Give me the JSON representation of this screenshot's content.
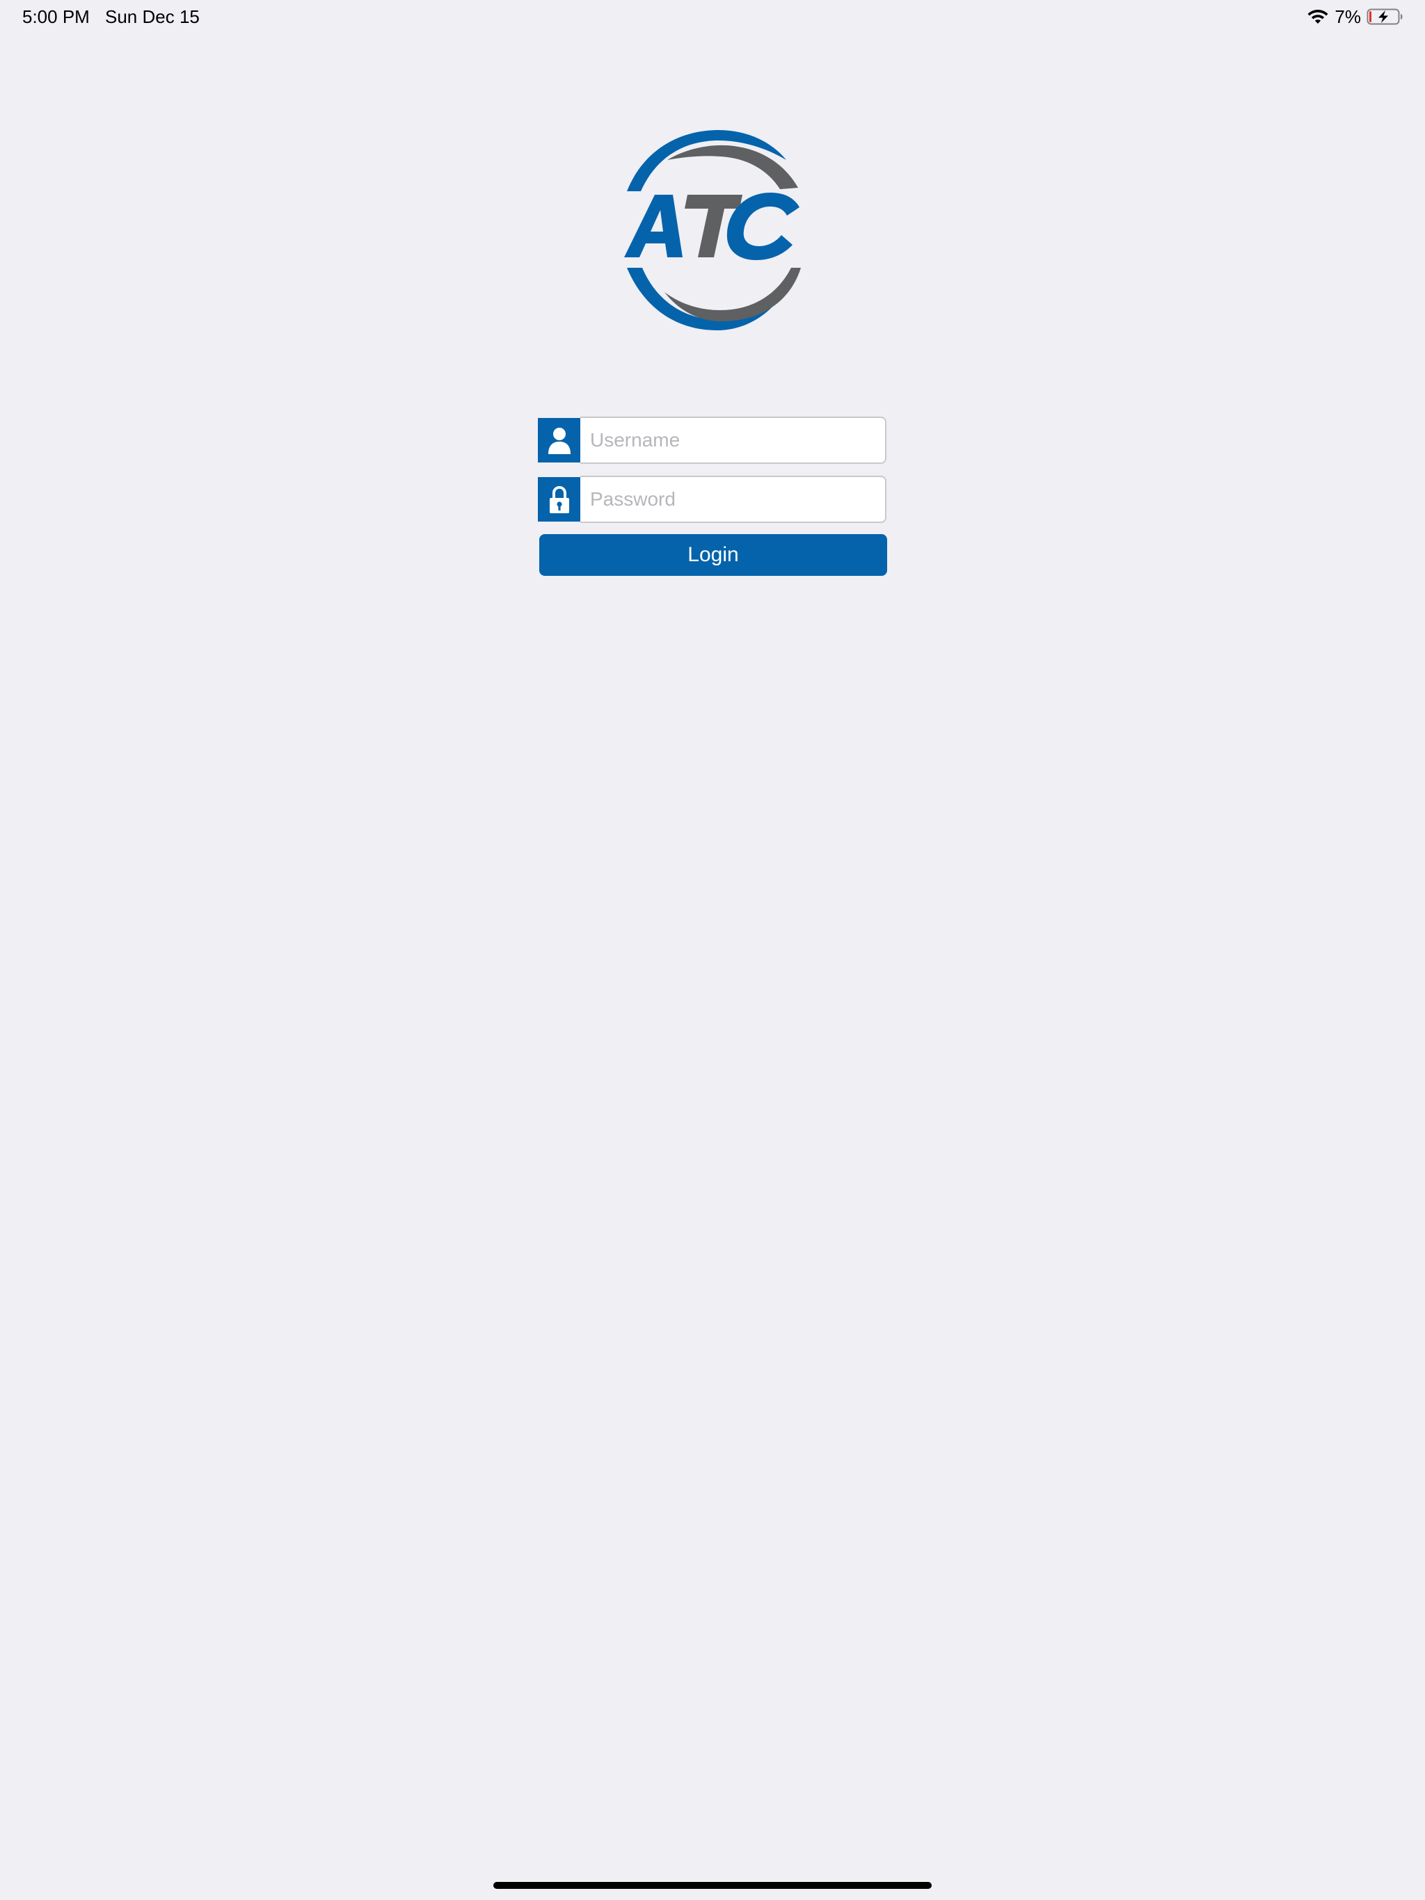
{
  "status_bar": {
    "time": "5:00 PM",
    "date": "Sun Dec 15",
    "battery_percent": "7%",
    "battery_level": 0.07,
    "battery_charging": true,
    "wifi_icon": "wifi-icon",
    "battery_icon": "battery-charging-icon"
  },
  "logo": {
    "text": "ATC",
    "colors": {
      "blue": "#0563ab",
      "gray": "#5f6062"
    }
  },
  "login_form": {
    "username": {
      "placeholder": "Username",
      "value": "",
      "icon": "user-icon"
    },
    "password": {
      "placeholder": "Password",
      "value": "",
      "icon": "lock-icon"
    },
    "login_label": "Login"
  },
  "colors": {
    "background": "#efeff4",
    "accent": "#0563ab",
    "placeholder": "#b6b6bb"
  }
}
